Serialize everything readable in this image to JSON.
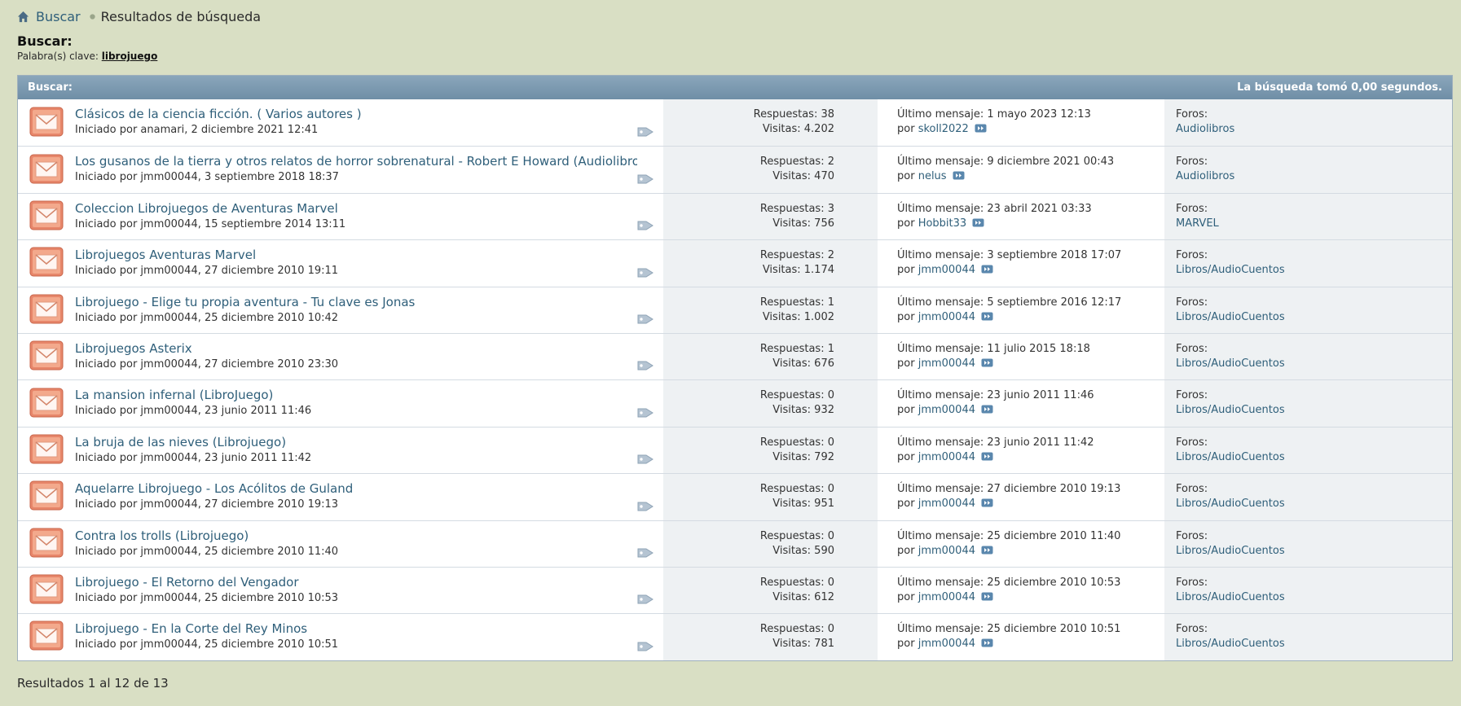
{
  "breadcrumb": {
    "home_icon": "home-icon",
    "link": "Buscar",
    "current": "Resultados de búsqueda"
  },
  "search": {
    "title": "Buscar:",
    "keywords_label": "Palabra(s) clave:",
    "keyword": "librojuego"
  },
  "panel": {
    "title": "Buscar:",
    "time_note": "La búsqueda tomó 0,00 segundos."
  },
  "rows": [
    {
      "title": "Clásicos de la ciencia ficción. ( Varios autores )",
      "started": "Iniciado por anamari,  2 diciembre 2021 12:41",
      "replies": "Respuestas: 38",
      "views": "Visitas: 4.202",
      "last_label": "Último mensaje: 1 mayo 2023 12:13",
      "by_prefix": "por",
      "last_user": "skoll2022",
      "forum_label": "Foros:",
      "forum": "Audiolibros"
    },
    {
      "title": "Los gusanos de la tierra y otros relatos de horror sobrenatural - Robert E Howard (Audiolibro Voz",
      "started": "Iniciado por jmm00044,  3 septiembre 2018 18:37",
      "replies": "Respuestas: 2",
      "views": "Visitas: 470",
      "last_label": "Último mensaje: 9 diciembre 2021 00:43",
      "by_prefix": "por",
      "last_user": "nelus",
      "forum_label": "Foros:",
      "forum": "Audiolibros"
    },
    {
      "title": "Coleccion Librojuegos de Aventuras Marvel",
      "started": "Iniciado por jmm00044, 15 septiembre 2014 13:11",
      "replies": "Respuestas: 3",
      "views": "Visitas: 756",
      "last_label": "Último mensaje: 23 abril 2021 03:33",
      "by_prefix": "por",
      "last_user": "Hobbit33",
      "forum_label": "Foros:",
      "forum": "MARVEL"
    },
    {
      "title": "Librojuegos Aventuras Marvel",
      "started": "Iniciado por jmm00044, 27 diciembre 2010 19:11",
      "replies": "Respuestas: 2",
      "views": "Visitas: 1.174",
      "last_label": "Último mensaje: 3 septiembre 2018 17:07",
      "by_prefix": "por",
      "last_user": "jmm00044",
      "forum_label": "Foros:",
      "forum": "Libros/AudioCuentos"
    },
    {
      "title": "Librojuego - Elige tu propia aventura - Tu clave es Jonas",
      "started": "Iniciado por jmm00044, 25 diciembre 2010 10:42",
      "replies": "Respuestas: 1",
      "views": "Visitas: 1.002",
      "last_label": "Último mensaje: 5 septiembre 2016 12:17",
      "by_prefix": "por",
      "last_user": "jmm00044",
      "forum_label": "Foros:",
      "forum": "Libros/AudioCuentos"
    },
    {
      "title": "Librojuegos Asterix",
      "started": "Iniciado por jmm00044, 27 diciembre 2010 23:30",
      "replies": "Respuestas: 1",
      "views": "Visitas: 676",
      "last_label": "Último mensaje: 11 julio 2015 18:18",
      "by_prefix": "por",
      "last_user": "jmm00044",
      "forum_label": "Foros:",
      "forum": "Libros/AudioCuentos"
    },
    {
      "title": "La mansion infernal (LibroJuego)",
      "started": "Iniciado por jmm00044, 23 junio 2011 11:46",
      "replies": "Respuestas: 0",
      "views": "Visitas: 932",
      "last_label": "Último mensaje: 23 junio 2011 11:46",
      "by_prefix": "por",
      "last_user": "jmm00044",
      "forum_label": "Foros:",
      "forum": "Libros/AudioCuentos"
    },
    {
      "title": "La bruja de las nieves (Librojuego)",
      "started": "Iniciado por jmm00044, 23 junio 2011 11:42",
      "replies": "Respuestas: 0",
      "views": "Visitas: 792",
      "last_label": "Último mensaje: 23 junio 2011 11:42",
      "by_prefix": "por",
      "last_user": "jmm00044",
      "forum_label": "Foros:",
      "forum": "Libros/AudioCuentos"
    },
    {
      "title": "Aquelarre Librojuego - Los Acólitos de Guland",
      "started": "Iniciado por jmm00044, 27 diciembre 2010 19:13",
      "replies": "Respuestas: 0",
      "views": "Visitas: 951",
      "last_label": "Último mensaje: 27 diciembre 2010 19:13",
      "by_prefix": "por",
      "last_user": "jmm00044",
      "forum_label": "Foros:",
      "forum": "Libros/AudioCuentos"
    },
    {
      "title": "Contra los trolls (Librojuego)",
      "started": "Iniciado por jmm00044, 25 diciembre 2010 11:40",
      "replies": "Respuestas: 0",
      "views": "Visitas: 590",
      "last_label": "Último mensaje: 25 diciembre 2010 11:40",
      "by_prefix": "por",
      "last_user": "jmm00044",
      "forum_label": "Foros:",
      "forum": "Libros/AudioCuentos"
    },
    {
      "title": "Librojuego - El Retorno del Vengador",
      "started": "Iniciado por jmm00044, 25 diciembre 2010 10:53",
      "replies": "Respuestas: 0",
      "views": "Visitas: 612",
      "last_label": "Último mensaje: 25 diciembre 2010 10:53",
      "by_prefix": "por",
      "last_user": "jmm00044",
      "forum_label": "Foros:",
      "forum": "Libros/AudioCuentos"
    },
    {
      "title": "Librojuego - En la Corte del Rey Minos",
      "started": "Iniciado por jmm00044, 25 diciembre 2010 10:51",
      "replies": "Respuestas: 0",
      "views": "Visitas: 781",
      "last_label": "Último mensaje: 25 diciembre 2010 10:51",
      "by_prefix": "por",
      "last_user": "jmm00044",
      "forum_label": "Foros:",
      "forum": "Libros/AudioCuentos"
    }
  ],
  "footer": {
    "results": "Resultados 1 al 12 de 13"
  },
  "colors": {
    "background": "#d9dfc4",
    "link": "#2f5f7a",
    "header": "#7b98ad",
    "envelope": "#ee9a7c"
  },
  "icons": {
    "row_icon": "envelope-icon",
    "tag_icon": "tag-icon",
    "goto_icon": "go-to-last-post-icon"
  }
}
